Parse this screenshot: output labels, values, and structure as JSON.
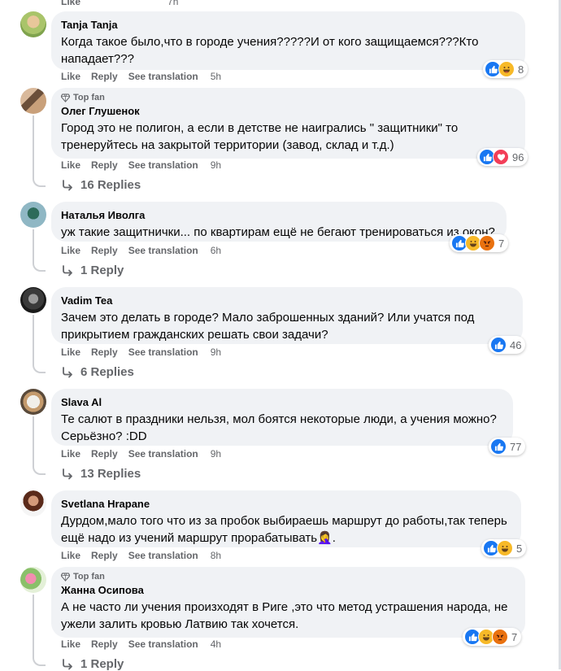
{
  "top_partial_actions": {
    "like": "Like",
    "time": "7h"
  },
  "comments": [
    {
      "author": "Tanja Tanja",
      "top_fan": "",
      "text": "Когда такое было,что в городе учения?????И от кого защищаемся???Кто нападает???",
      "actions": {
        "like": "Like",
        "reply": "Reply",
        "translate": "See translation",
        "time": "5h"
      },
      "reactions": {
        "types": [
          "like",
          "haha"
        ],
        "count": "8"
      },
      "replies": ""
    },
    {
      "author": "Олег Глушенок",
      "top_fan": "Top fan",
      "text": "Город это не полигон, а если в детстве не наигрались \" защитники\" то тренеруйтесь на закрытой территории (завод, склад и т.д.)",
      "actions": {
        "like": "Like",
        "reply": "Reply",
        "translate": "See translation",
        "time": "9h"
      },
      "reactions": {
        "types": [
          "like",
          "love"
        ],
        "count": "96"
      },
      "replies": "16 Replies"
    },
    {
      "author": "Наталья Иволга",
      "top_fan": "",
      "text": "уж такие защитнички... по квартирам ещё не бегают тренироваться из окон?",
      "actions": {
        "like": "Like",
        "reply": "Reply",
        "translate": "See translation",
        "time": "6h"
      },
      "reactions": {
        "types": [
          "like",
          "haha",
          "angry"
        ],
        "count": "7"
      },
      "replies": "1 Reply"
    },
    {
      "author": "Vadim Tea",
      "top_fan": "",
      "text": "Зачем это делать в городе? Мало заброшенных зданий? Или учатся под прикрытием гражданских решать свои задачи?",
      "actions": {
        "like": "Like",
        "reply": "Reply",
        "translate": "See translation",
        "time": "9h"
      },
      "reactions": {
        "types": [
          "like"
        ],
        "count": "46"
      },
      "replies": "6 Replies"
    },
    {
      "author": "Slava Al",
      "top_fan": "",
      "text": "Те салют в праздники нельзя, мол боятся некоторые люди, а учения можно? Серьёзно? :DD",
      "actions": {
        "like": "Like",
        "reply": "Reply",
        "translate": "See translation",
        "time": "9h"
      },
      "reactions": {
        "types": [
          "like"
        ],
        "count": "77"
      },
      "replies": "13 Replies"
    },
    {
      "author": "Svetlana Hrapane",
      "top_fan": "",
      "text": "Дурдом,мало того что из за пробок выбираешь маршрут до работы,так теперь ещё надо из учений маршрут прорабатывать🤦‍♀️.",
      "actions": {
        "like": "Like",
        "reply": "Reply",
        "translate": "See translation",
        "time": "8h"
      },
      "reactions": {
        "types": [
          "like",
          "haha"
        ],
        "count": "5"
      },
      "replies": ""
    },
    {
      "author": "Жанна Осипова",
      "top_fan": "Top fan",
      "text": "А не часто ли учения произходят в Риге ,это что метод устрашения народа, не ужели залить кровью Латвию так хочется.",
      "actions": {
        "like": "Like",
        "reply": "Reply",
        "translate": "See translation",
        "time": "4h"
      },
      "reactions": {
        "types": [
          "like",
          "haha",
          "angry"
        ],
        "count": "7"
      },
      "replies": "1 Reply"
    }
  ],
  "colors": {
    "bubble": "#f0f2f5",
    "muted": "#65676b",
    "like_blue": "#1877f2",
    "love_red": "#f33e58",
    "haha_yellow": "#f7b928",
    "angry_orange": "#e9710f"
  }
}
